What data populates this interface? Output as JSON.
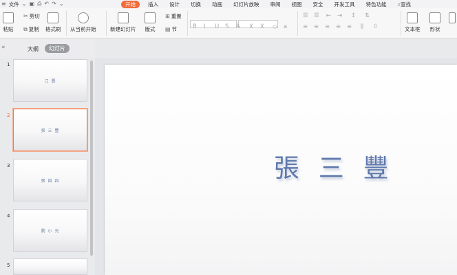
{
  "menubar": {
    "file_label": "文件",
    "tabs": [
      "开始",
      "插入",
      "设计",
      "切换",
      "动画",
      "幻灯片放映",
      "审阅",
      "视图",
      "安全",
      "开发工具",
      "特色功能"
    ],
    "active_tab": "开始",
    "search_label": "查找",
    "accent": "#f26b3a"
  },
  "ribbon": {
    "paste": "粘贴",
    "cut": "剪切",
    "copy": "复制",
    "format_painter": "格式刷",
    "from_current": "从当前开始",
    "new_slide": "新建幻灯片",
    "layout": "版式",
    "reset": "重置",
    "section": "节",
    "textbox": "文本框",
    "shape": "形状"
  },
  "panel": {
    "outline_tab": "大纲",
    "slides_tab": "幻灯片"
  },
  "slides": [
    {
      "num": "1",
      "text": "江 豐"
    },
    {
      "num": "2",
      "text": "張 三 豐"
    },
    {
      "num": "3",
      "text": "張 四 四"
    },
    {
      "num": "4",
      "text": "劉 小 光"
    },
    {
      "num": "5",
      "text": ""
    }
  ],
  "selected_slide": "2",
  "current_slide": {
    "title": "張 三 豐",
    "title_color": "#5f79ad"
  }
}
